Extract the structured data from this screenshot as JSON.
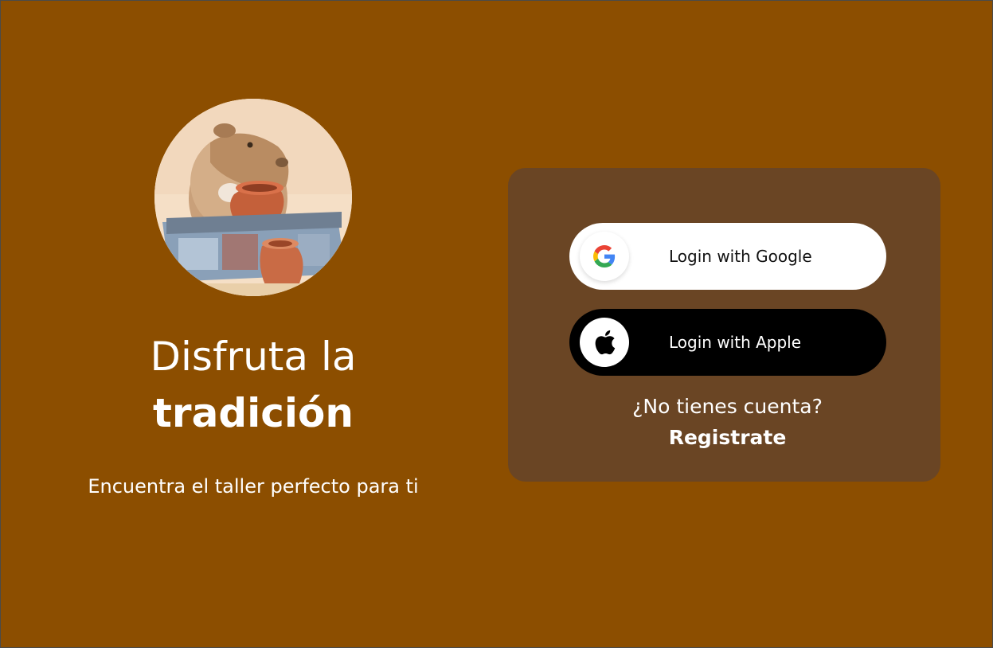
{
  "hero": {
    "headline_line1": "Disfruta la",
    "headline_line2": "tradición",
    "subtitle": "Encuentra el taller perfecto para ti",
    "avatar_icon": "capybara-pottery-illustration"
  },
  "login": {
    "google_label": "Login with Google",
    "google_icon": "google-icon",
    "apple_label": "Login with Apple",
    "apple_icon": "apple-icon",
    "no_account_text": "¿No tienes cuenta?",
    "register_link": "Registrate"
  },
  "colors": {
    "background": "#8c4e00",
    "card": "#6a4524",
    "google_button": "#ffffff",
    "apple_button": "#000000",
    "text": "#ffffff"
  }
}
